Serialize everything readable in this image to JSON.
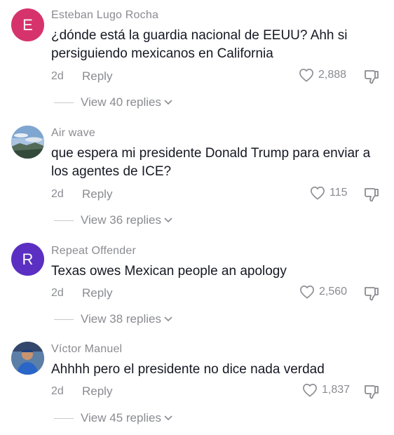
{
  "colors": {
    "avatar_e": "#d6336c",
    "avatar_r": "#5b2fc2",
    "text_primary": "#161823",
    "text_secondary": "#8a8b91"
  },
  "comments": [
    {
      "avatar_letter": "E",
      "username": "Esteban Lugo Rocha",
      "text": "¿dónde está la guardia nacional de EEUU? Ahh si persiguiendo mexicanos en California",
      "time": "2d",
      "reply_label": "Reply",
      "likes": "2,888",
      "view_replies": "View 40 replies"
    },
    {
      "avatar_icon": "landscape-avatar",
      "username": "Air wave",
      "text": "que espera mi presidente Donald Trump para enviar a los agentes de ICE?",
      "time": "2d",
      "reply_label": "Reply",
      "likes": "115",
      "view_replies": "View 36 replies"
    },
    {
      "avatar_letter": "R",
      "username": "Repeat Offender",
      "text": "Texas owes Mexican people an apology",
      "time": "2d",
      "reply_label": "Reply",
      "likes": "2,560",
      "view_replies": "View 38 replies"
    },
    {
      "avatar_icon": "person-photo-avatar",
      "username": "Víctor Manuel",
      "text": "Ahhhh pero el presidente no dice nada verdad",
      "time": "2d",
      "reply_label": "Reply",
      "likes": "1,837",
      "view_replies": "View 45 replies"
    }
  ]
}
